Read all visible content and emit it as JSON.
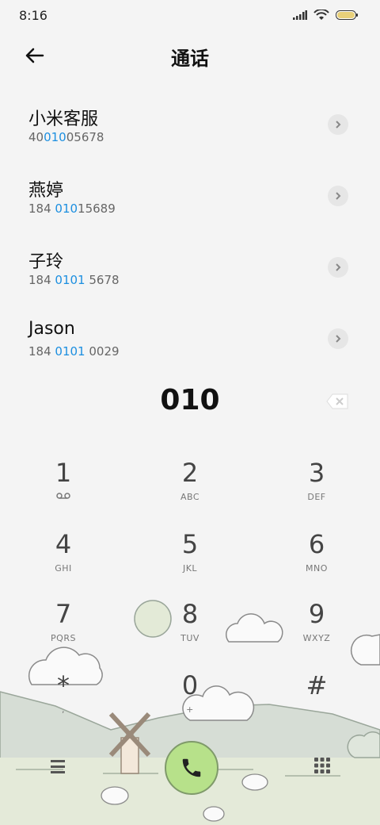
{
  "status": {
    "time": "8:16"
  },
  "header": {
    "title": "通话"
  },
  "contacts": [
    {
      "name": "小米客服",
      "num_pre": "40",
      "num_hl": "010",
      "num_post": "05678"
    },
    {
      "name": "燕婷",
      "num_pre": "184 ",
      "num_hl": "010",
      "num_post": "15689"
    },
    {
      "name": "子玲",
      "num_pre": "184 ",
      "num_hl": "0101",
      "num_post": " 5678"
    },
    {
      "name": "Jason",
      "num_pre": "184 ",
      "num_hl": "0101",
      "num_post": " 0029"
    }
  ],
  "dialer": {
    "input": "010"
  },
  "keys": [
    {
      "digit": "1",
      "letters": ""
    },
    {
      "digit": "2",
      "letters": "ABC"
    },
    {
      "digit": "3",
      "letters": "DEF"
    },
    {
      "digit": "4",
      "letters": "GHI"
    },
    {
      "digit": "5",
      "letters": "JKL"
    },
    {
      "digit": "6",
      "letters": "MNO"
    },
    {
      "digit": "7",
      "letters": "PQRS"
    },
    {
      "digit": "8",
      "letters": "TUV"
    },
    {
      "digit": "9",
      "letters": "WXYZ"
    },
    {
      "digit": "*",
      "letters": ","
    },
    {
      "digit": "0",
      "letters": "+"
    },
    {
      "digit": "#",
      "letters": ""
    }
  ],
  "colors": {
    "highlight": "#1c8fe0",
    "call": "#b7e18a",
    "background": "#f4f4f4"
  },
  "icons": {
    "back": "arrow-left-icon",
    "chevron": "chevron-right-icon",
    "delete": "backspace-icon",
    "voicemail": "voicemail-icon",
    "menu": "menu-icon",
    "call": "phone-icon",
    "keypad": "keypad-icon"
  }
}
